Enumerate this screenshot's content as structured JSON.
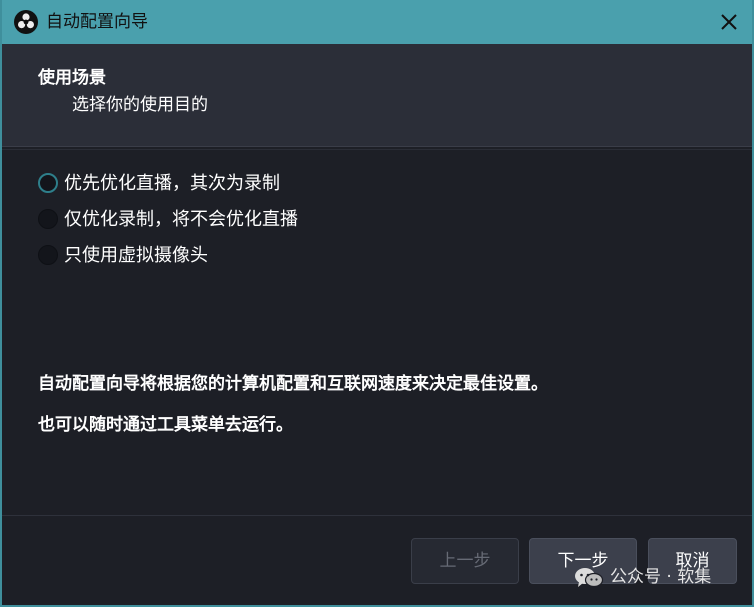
{
  "window": {
    "title": "自动配置向导",
    "app_icon": "obs-icon",
    "close_icon": "close-icon",
    "titlebar_color": "#4aa0ad"
  },
  "header": {
    "title": "使用场景",
    "subtitle": "选择你的使用目的"
  },
  "options": [
    {
      "label": "优先优化直播，其次为录制",
      "selected": false,
      "focused": true
    },
    {
      "label": "仅优化录制，将不会优化直播",
      "selected": false,
      "focused": false
    },
    {
      "label": "只使用虚拟摄像头",
      "selected": false,
      "focused": false
    }
  ],
  "info": {
    "line1": "自动配置向导将根据您的计算机配置和互联网速度来决定最佳设置。",
    "line2": "也可以随时通过工具菜单去运行。"
  },
  "buttons": {
    "back": "上一步",
    "next": "下一步",
    "cancel": "取消"
  },
  "watermark": {
    "icon": "wechat-icon",
    "text": "公众号 · 软集"
  }
}
